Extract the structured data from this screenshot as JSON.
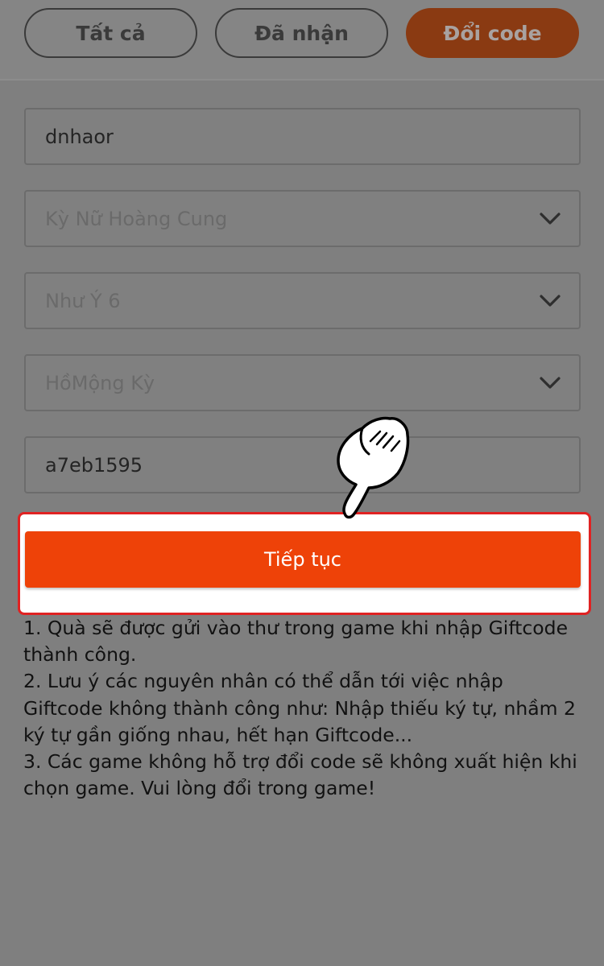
{
  "tabs": [
    {
      "label": "Tất cả"
    },
    {
      "label": "Đã nhận"
    },
    {
      "label": "Đổi code"
    }
  ],
  "form": {
    "account": "dnhaor",
    "game": "Kỳ Nữ Hoàng Cung",
    "server": "Như Ý 6",
    "character": "HồMộng Kỳ",
    "code": "a7eb1595",
    "submit_label": "Tiếp tục"
  },
  "notes": [
    "1. Quà sẽ được gửi vào thư trong game khi nhập Giftcode thành công.",
    "2. Lưu ý các nguyên nhân có thể dẫn tới việc nhập Giftcode không thành công như: Nhập thiếu ký tự, nhầm 2 ký tự gần giống nhau, hết hạn Giftcode...",
    "3. Các game không hỗ trợ đổi code sẽ không xuất hiện khi chọn game. Vui lòng đổi trong game!"
  ],
  "icons": {
    "dropdown": "chevron-down-icon",
    "pointer": "pointing-hand-icon"
  },
  "colors": {
    "accent": "#ee4208",
    "highlight_border": "#e02222",
    "overlay": "#7f7f7f"
  }
}
